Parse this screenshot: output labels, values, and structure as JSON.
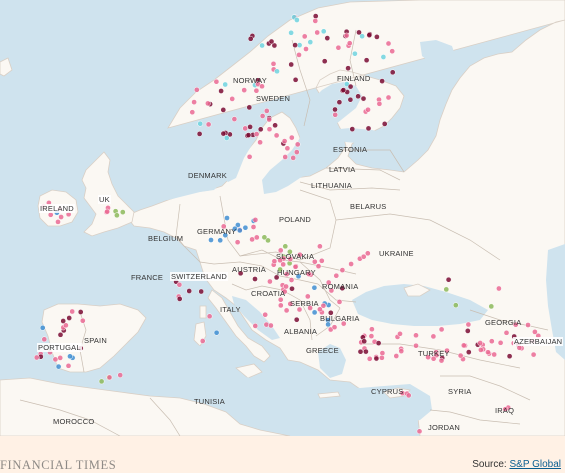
{
  "labels": {
    "norway": "NORWAY",
    "sweden": "SWEDEN",
    "finland": "FINLAND",
    "estonia": "ESTONIA",
    "latvia": "LATVIA",
    "lithuania": "LITHUANIA",
    "denmark": "DENMARK",
    "ireland": "IRELAND",
    "uk": "UK",
    "belarus": "BELARUS",
    "poland": "POLAND",
    "germany": "GERMANY",
    "belgium": "BELGIUM",
    "ukraine": "UKRAINE",
    "slovakia": "SLOVAKIA",
    "france": "FRANCE",
    "switzerland": "SWITZERLAND",
    "austria": "AUSTRIA",
    "hungary": "HUNGARY",
    "romania": "ROMANIA",
    "croatia": "CROATIA",
    "serbia": "SERBIA",
    "bulgaria": "BULGARIA",
    "italy": "ITALY",
    "albania": "ALBANIA",
    "greece": "GREECE",
    "georgia": "GEORGIA",
    "azerbaijan": "AZERBAIJAN",
    "turkey": "TURKEY",
    "portugal": "PORTUGAL",
    "spain": "SPAIN",
    "cyprus": "CYPRUS",
    "syria": "SYRIA",
    "tunisia": "TUNISIA",
    "morocco": "MOROCCO",
    "iraq": "IRAQ",
    "jordan": "JORDAN"
  },
  "footer": {
    "brand": "FINANCIAL TIMES",
    "source_prefix": "Source: ",
    "source_link": "S&P Global"
  },
  "colors": {
    "sea": "#cfe3ee",
    "land": "#fbf8f3",
    "pink": "#ea6a93",
    "maroon": "#7a0c33",
    "blue": "#3f8ed1",
    "cyan": "#6fd3de",
    "green": "#8cba5a",
    "footer_bg": "#fff1e5"
  }
}
